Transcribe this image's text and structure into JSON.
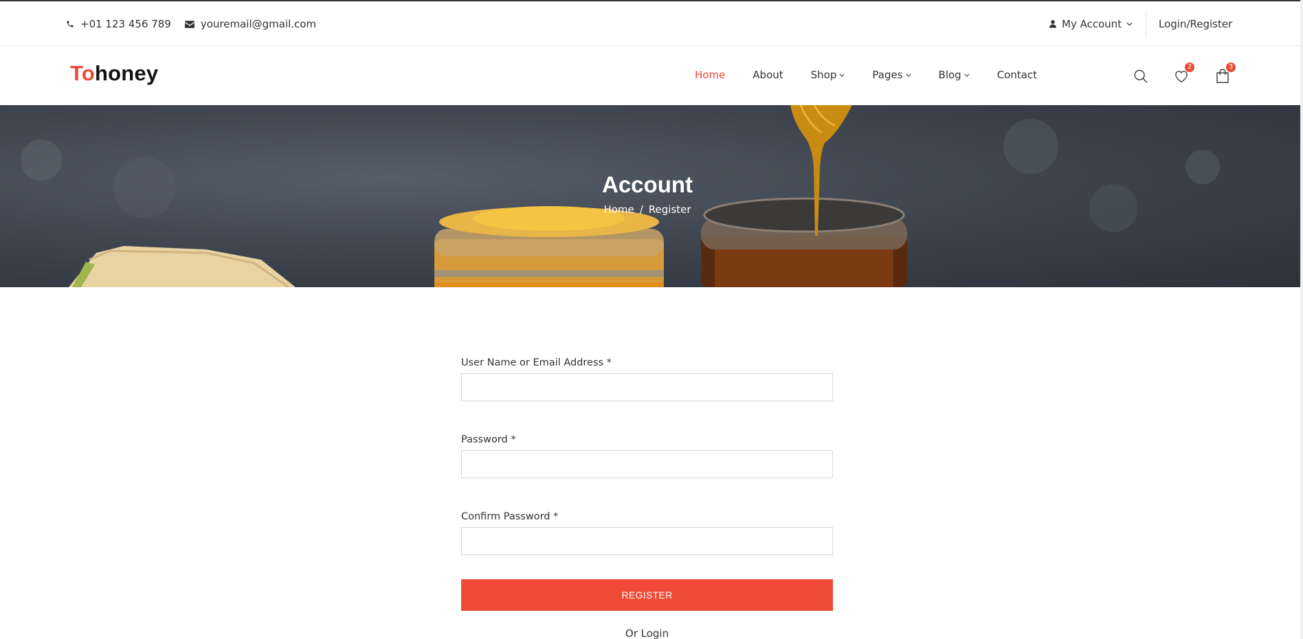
{
  "topbar": {
    "phone": "+01 123 456 789",
    "email": "youremail@gmail.com",
    "account_label": "My Account",
    "login_register": "Login/Register"
  },
  "header": {
    "logo_prefix": "To",
    "logo_suffix": "honey",
    "nav": [
      {
        "label": "Home",
        "active": true
      },
      {
        "label": "About"
      },
      {
        "label": "Shop",
        "dropdown": true
      },
      {
        "label": "Pages",
        "dropdown": true
      },
      {
        "label": "Blog",
        "dropdown": true
      },
      {
        "label": "Contact"
      }
    ],
    "wishlist_count": "2",
    "cart_count": "3",
    "icons": [
      "search-icon",
      "heart-icon",
      "shopping-bag-icon"
    ]
  },
  "hero": {
    "title": "Account",
    "breadcrumb_home": "Home",
    "breadcrumb_sep": "/",
    "breadcrumb_current": "Register"
  },
  "form": {
    "username_label": "User Name or Email Address *",
    "password_label": "Password *",
    "confirm_label": "Confirm Password *",
    "username_value": "",
    "password_value": "",
    "confirm_value": "",
    "submit_label": "REGISTER",
    "alt_link": "Or Login"
  },
  "colors": {
    "accent": "#ef4a35",
    "text": "#333333"
  }
}
